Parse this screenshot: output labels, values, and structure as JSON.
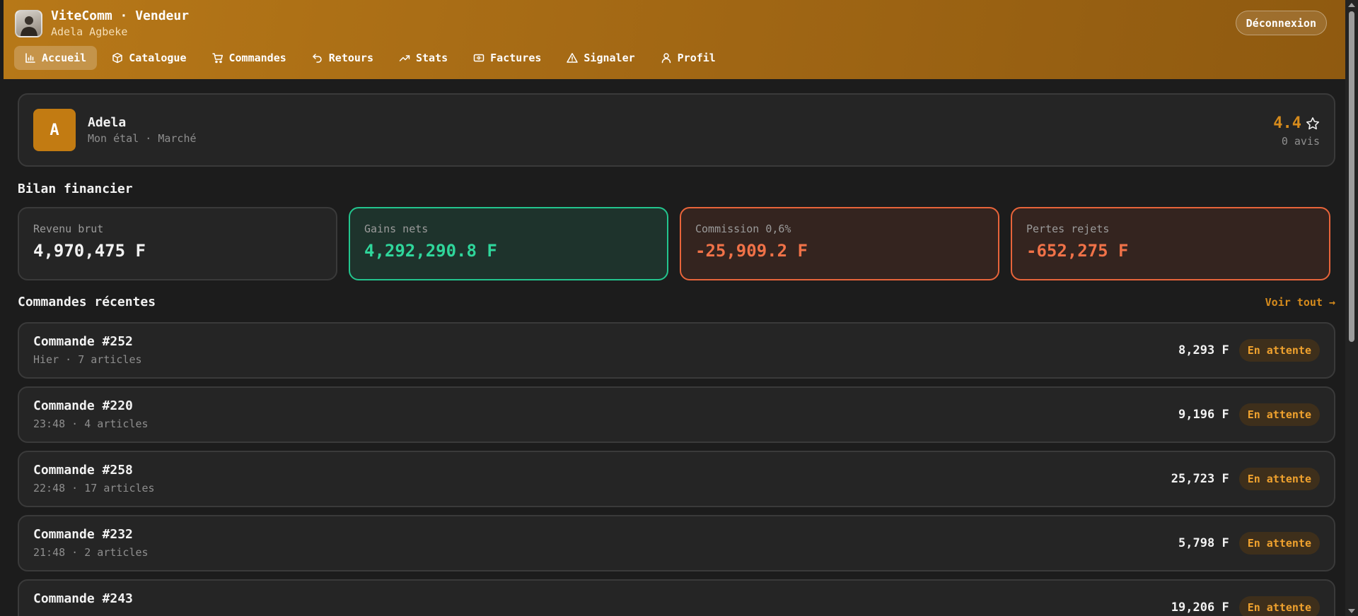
{
  "app": {
    "title": "ViteComm · Vendeur",
    "user_name": "Adela Agbeke",
    "logout_label": "Déconnexion"
  },
  "nav": {
    "items": [
      {
        "label": "Accueil",
        "icon": "bar-chart-icon",
        "active": true
      },
      {
        "label": "Catalogue",
        "icon": "box-icon",
        "active": false
      },
      {
        "label": "Commandes",
        "icon": "cart-icon",
        "active": false
      },
      {
        "label": "Retours",
        "icon": "undo-icon",
        "active": false
      },
      {
        "label": "Stats",
        "icon": "trend-up-icon",
        "active": false
      },
      {
        "label": "Factures",
        "icon": "invoice-icon",
        "active": false
      },
      {
        "label": "Signaler",
        "icon": "warning-icon",
        "active": false
      },
      {
        "label": "Profil",
        "icon": "user-icon",
        "active": false
      }
    ]
  },
  "profile": {
    "initial": "A",
    "name": "Adela",
    "subtitle": "Mon étal · Marché",
    "rating": "4.4",
    "reviews": "0 avis"
  },
  "finance": {
    "title": "Bilan financier",
    "cards": [
      {
        "label": "Revenu brut",
        "value": "4,970,475 F",
        "tone": "neutral"
      },
      {
        "label": "Gains nets",
        "value": "4,292,290.8 F",
        "tone": "green"
      },
      {
        "label": "Commission 0,6%",
        "value": "-25,909.2 F",
        "tone": "red"
      },
      {
        "label": "Pertes rejets",
        "value": "-652,275 F",
        "tone": "red"
      }
    ]
  },
  "orders": {
    "title": "Commandes récentes",
    "see_all": "Voir tout →",
    "items": [
      {
        "title": "Commande #252",
        "meta": "Hier · 7 articles",
        "amount": "8,293 F",
        "status": "En attente"
      },
      {
        "title": "Commande #220",
        "meta": "23:48 · 4 articles",
        "amount": "9,196 F",
        "status": "En attente"
      },
      {
        "title": "Commande #258",
        "meta": "22:48 · 17 articles",
        "amount": "25,723 F",
        "status": "En attente"
      },
      {
        "title": "Commande #232",
        "meta": "21:48 · 2 articles",
        "amount": "5,798 F",
        "status": "En attente"
      },
      {
        "title": "Commande #243",
        "meta": "",
        "amount": "19,206 F",
        "status": "En attente"
      }
    ]
  },
  "colors": {
    "header_accent": "#b77818",
    "gain": "#23c58e",
    "loss": "#e8643a",
    "pending": "#f0a22e"
  }
}
